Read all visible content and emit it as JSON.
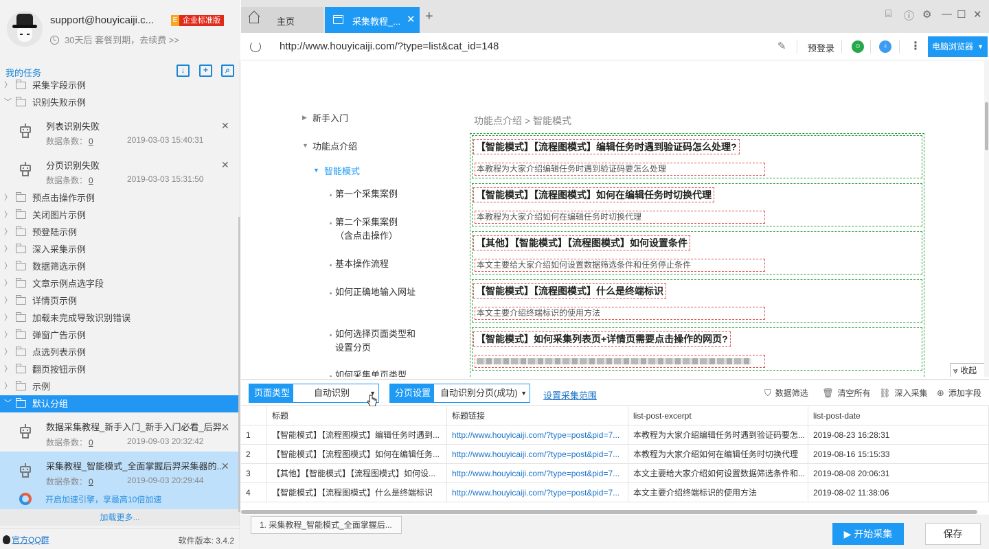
{
  "user": {
    "email": "support@houyicaiji.c...",
    "badge_e": "E",
    "badge": "企业标准版",
    "expiry": "30天后 套餐到期，去续费 >>"
  },
  "tasks_header": {
    "title": "我的任务"
  },
  "tree": {
    "items_top": [
      "采集字段示例",
      "识别失败示例"
    ],
    "failed_tasks": [
      {
        "name": "列表识别失败",
        "count_label": "数据条数：",
        "count": "0",
        "time": "2019-03-03 15:40:31"
      },
      {
        "name": "分页识别失败",
        "count_label": "数据条数：",
        "count": "0",
        "time": "2019-03-03 15:31:50"
      }
    ],
    "items_mid": [
      "预点击操作示例",
      "关闭图片示例",
      "预登陆示例",
      "深入采集示例",
      "数据筛选示例",
      "文章示例点选字段",
      "详情页示例",
      "加载未完成导致识别错误",
      "弹窗广告示例",
      "点选列表示例",
      "翻页按钮示例",
      "示例"
    ],
    "default_group": "默认分组",
    "default_tasks": [
      {
        "name": "数据采集教程_新手入门_新手入门必看_后羿...",
        "count_label": "数据条数：",
        "count": "0",
        "time": "2019-09-03 20:32:42"
      },
      {
        "name": "采集教程_智能模式_全面掌握后羿采集器的...",
        "count_label": "数据条数：",
        "count": "0",
        "time": "2019-09-03 20:29:44"
      }
    ],
    "speed_text": "开启加速引擎，享最高10倍加速",
    "load_more": "加载更多..."
  },
  "footer": {
    "qq": "官方QQ群",
    "version": "软件版本: 3.4.2"
  },
  "tabs": {
    "home": "主页",
    "active": "采集教程_..."
  },
  "address": {
    "url": "http://www.houyicaiji.com/?type=list&cat_id=148",
    "prelogin": "预登录",
    "browser": "电脑浏览器"
  },
  "web": {
    "nav": {
      "newbie": "新手入门",
      "features": "功能点介绍",
      "smart": "智能模式",
      "sub": [
        "第一个采集案例",
        "第二个采集案例（含点击操作）",
        "基本操作流程",
        "如何正确地输入网址",
        "如何选择页面类型和设置分页",
        "如何采集单页类型"
      ]
    },
    "breadcrumb": "功能点介绍 > 智能模式",
    "articles": [
      {
        "title": "【智能模式】【流程图模式】编辑任务时遇到验证码怎么处理?",
        "desc": "本教程为大家介绍编辑任务时遇到验证码要怎么处理"
      },
      {
        "title": "【智能模式】【流程图模式】如何在编辑任务时切换代理",
        "desc": "本教程为大家介绍如何在编辑任务时切换代理"
      },
      {
        "title": "【其他】【智能模式】【流程图模式】如何设置条件",
        "desc": "本文主要给大家介绍如何设置数据筛选条件和任务停止条件"
      },
      {
        "title": "【智能模式】【流程图模式】什么是终端标识",
        "desc": "本文主要介绍终端标识的使用方法"
      },
      {
        "title": "【智能模式】如何采集列表页+详情页需要点击操作的网页?",
        "desc": ""
      }
    ],
    "collapse": "收起"
  },
  "config": {
    "page_type_label": "页面类型",
    "page_type_value": "自动识别",
    "paging_label": "分页设置",
    "paging_value": "自动识别分页(成功)",
    "range_link": "设置采集范围",
    "tools": {
      "filter": "数据筛选",
      "clear": "清空所有",
      "deep": "深入采集",
      "add_field": "添加字段"
    }
  },
  "table": {
    "columns": [
      "标题",
      "标题链接",
      "list-post-excerpt",
      "list-post-date"
    ],
    "rows": [
      {
        "n": "1",
        "title": "【智能模式】【流程图模式】编辑任务时遇到...",
        "link": "http://www.houyicaiji.com/?type=post&pid=7...",
        "excerpt": "本教程为大家介绍编辑任务时遇到验证码要怎...",
        "date": "2019-08-23 16:28:31"
      },
      {
        "n": "2",
        "title": "【智能模式】【流程图模式】如何在编辑任务...",
        "link": "http://www.houyicaiji.com/?type=post&pid=7...",
        "excerpt": "本教程为大家介绍如何在编辑任务时切换代理",
        "date": "2019-08-16 15:15:33"
      },
      {
        "n": "3",
        "title": "【其他】【智能模式】【流程图模式】如何设...",
        "link": "http://www.houyicaiji.com/?type=post&pid=7...",
        "excerpt": "本文主要给大家介绍如何设置数据筛选条件和...",
        "date": "2019-08-08 20:06:31"
      },
      {
        "n": "4",
        "title": "【智能模式】【流程图模式】什么是终端标识",
        "link": "http://www.houyicaiji.com/?type=post&pid=7...",
        "excerpt": "本文主要介绍终端标识的使用方法",
        "date": "2019-08-02 11:38:06"
      }
    ]
  },
  "bottom": {
    "task_tab": "1. 采集教程_智能模式_全面掌握后...",
    "start": "开始采集",
    "save": "保存"
  },
  "colors": {
    "accent": "#1e9af5",
    "badge_red": "#e02a1a",
    "green_dashed": "#2e9e3e",
    "red_dashed": "#e05050"
  },
  "icons": [
    "gift-icon",
    "help-icon",
    "settings-icon",
    "minimize-icon",
    "maximize-icon",
    "close-icon"
  ]
}
